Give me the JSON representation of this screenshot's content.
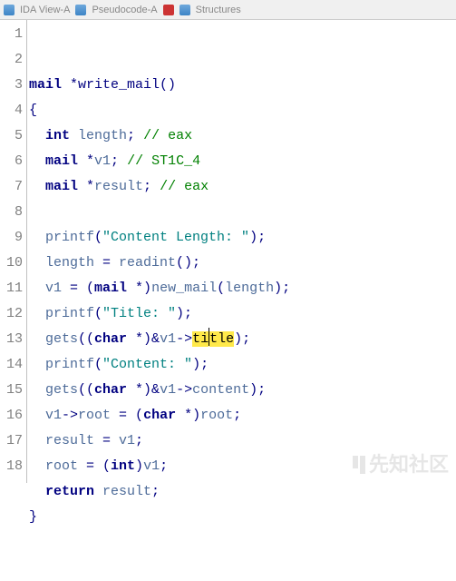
{
  "tabs": {
    "left_label": "IDA View-A",
    "mid_label": "Pseudocode-A",
    "right_label": "Structures"
  },
  "code": {
    "lines": [
      {
        "n": 1,
        "tokens": [
          [
            "type",
            "mail"
          ],
          [
            "punct",
            " *"
          ],
          [
            "func",
            "write_mail"
          ],
          [
            "punct",
            "()"
          ]
        ]
      },
      {
        "n": 2,
        "tokens": [
          [
            "punct",
            "{"
          ]
        ]
      },
      {
        "n": 3,
        "indent": 1,
        "tokens": [
          [
            "kw",
            "int"
          ],
          [
            "punct",
            " "
          ],
          [
            "ident",
            "length"
          ],
          [
            "punct",
            "; "
          ],
          [
            "comment",
            "// eax"
          ]
        ]
      },
      {
        "n": 4,
        "indent": 1,
        "tokens": [
          [
            "type",
            "mail"
          ],
          [
            "punct",
            " *"
          ],
          [
            "ident",
            "v1"
          ],
          [
            "punct",
            "; "
          ],
          [
            "comment",
            "// ST1C_4"
          ]
        ]
      },
      {
        "n": 5,
        "indent": 1,
        "tokens": [
          [
            "type",
            "mail"
          ],
          [
            "punct",
            " *"
          ],
          [
            "ident",
            "result"
          ],
          [
            "punct",
            "; "
          ],
          [
            "comment",
            "// eax"
          ]
        ]
      },
      {
        "n": 6,
        "indent": 0,
        "tokens": []
      },
      {
        "n": 7,
        "indent": 1,
        "tokens": [
          [
            "call",
            "printf"
          ],
          [
            "punct",
            "("
          ],
          [
            "str",
            "\"Content Length: \""
          ],
          [
            "punct",
            ");"
          ]
        ]
      },
      {
        "n": 8,
        "indent": 1,
        "tokens": [
          [
            "ident",
            "length"
          ],
          [
            "punct",
            " = "
          ],
          [
            "call",
            "readint"
          ],
          [
            "punct",
            "();"
          ]
        ]
      },
      {
        "n": 9,
        "indent": 1,
        "tokens": [
          [
            "ident",
            "v1"
          ],
          [
            "punct",
            " = ("
          ],
          [
            "type",
            "mail"
          ],
          [
            "punct",
            " *)"
          ],
          [
            "call",
            "new_mail"
          ],
          [
            "punct",
            "("
          ],
          [
            "ident",
            "length"
          ],
          [
            "punct",
            ");"
          ]
        ]
      },
      {
        "n": 10,
        "indent": 1,
        "tokens": [
          [
            "call",
            "printf"
          ],
          [
            "punct",
            "("
          ],
          [
            "str",
            "\"Title: \""
          ],
          [
            "punct",
            ");"
          ]
        ]
      },
      {
        "n": 11,
        "indent": 1,
        "tokens": [
          [
            "call",
            "gets"
          ],
          [
            "punct",
            "(("
          ],
          [
            "kw",
            "char"
          ],
          [
            "punct",
            " *)&"
          ],
          [
            "ident",
            "v1"
          ],
          [
            "punct",
            "->"
          ],
          [
            "hl",
            "ti"
          ],
          [
            "cursor",
            ""
          ],
          [
            "hl",
            "tle"
          ],
          [
            "punct",
            ");"
          ]
        ]
      },
      {
        "n": 12,
        "indent": 1,
        "tokens": [
          [
            "call",
            "printf"
          ],
          [
            "punct",
            "("
          ],
          [
            "str",
            "\"Content: \""
          ],
          [
            "punct",
            ");"
          ]
        ]
      },
      {
        "n": 13,
        "indent": 1,
        "tokens": [
          [
            "call",
            "gets"
          ],
          [
            "punct",
            "(("
          ],
          [
            "kw",
            "char"
          ],
          [
            "punct",
            " *)&"
          ],
          [
            "ident",
            "v1"
          ],
          [
            "punct",
            "->"
          ],
          [
            "field",
            "content"
          ],
          [
            "punct",
            ");"
          ]
        ]
      },
      {
        "n": 14,
        "indent": 1,
        "tokens": [
          [
            "ident",
            "v1"
          ],
          [
            "punct",
            "->"
          ],
          [
            "field",
            "root"
          ],
          [
            "punct",
            " = ("
          ],
          [
            "kw",
            "char"
          ],
          [
            "punct",
            " *)"
          ],
          [
            "ident",
            "root"
          ],
          [
            "punct",
            ";"
          ]
        ]
      },
      {
        "n": 15,
        "indent": 1,
        "tokens": [
          [
            "ident",
            "result"
          ],
          [
            "punct",
            " = "
          ],
          [
            "ident",
            "v1"
          ],
          [
            "punct",
            ";"
          ]
        ]
      },
      {
        "n": 16,
        "indent": 1,
        "tokens": [
          [
            "ident",
            "root"
          ],
          [
            "punct",
            " = ("
          ],
          [
            "kw",
            "int"
          ],
          [
            "punct",
            ")"
          ],
          [
            "ident",
            "v1"
          ],
          [
            "punct",
            ";"
          ]
        ]
      },
      {
        "n": 17,
        "indent": 1,
        "tokens": [
          [
            "kw",
            "return"
          ],
          [
            "punct",
            " "
          ],
          [
            "ident",
            "result"
          ],
          [
            "punct",
            ";"
          ]
        ]
      },
      {
        "n": 18,
        "tokens": [
          [
            "punct",
            "}"
          ]
        ]
      }
    ]
  },
  "watermark": "先知社区"
}
